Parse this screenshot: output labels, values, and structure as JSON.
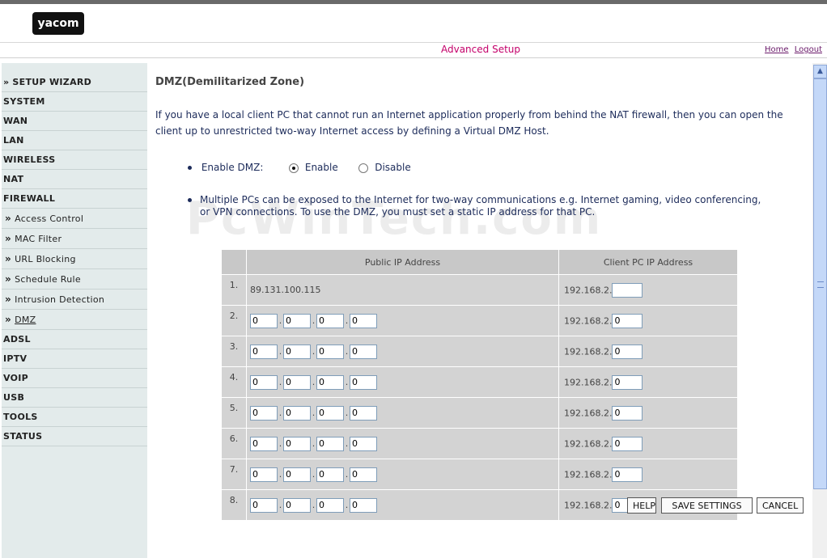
{
  "header": {
    "logo_text": "yacom",
    "page_heading": "Advanced Setup",
    "home_link": "Home",
    "logout_link": "Logout"
  },
  "sidebar": {
    "items": [
      {
        "label": "SETUP WIZARD",
        "prefix": "»"
      },
      {
        "label": "SYSTEM"
      },
      {
        "label": "WAN"
      },
      {
        "label": "LAN"
      },
      {
        "label": "WIRELESS"
      },
      {
        "label": "NAT"
      },
      {
        "label": "FIREWALL"
      }
    ],
    "firewall_sub": [
      {
        "label": "Access Control"
      },
      {
        "label": "MAC Filter"
      },
      {
        "label": "URL Blocking"
      },
      {
        "label": "Schedule Rule"
      },
      {
        "label": "Intrusion Detection"
      },
      {
        "label": "DMZ"
      }
    ],
    "lower_items": [
      {
        "label": "ADSL"
      },
      {
        "label": "IPTV"
      },
      {
        "label": "VOIP"
      },
      {
        "label": "USB"
      },
      {
        "label": "TOOLS"
      },
      {
        "label": "STATUS"
      }
    ]
  },
  "main": {
    "title": "DMZ(Demilitarized Zone)",
    "intro": "If you have a local client PC that cannot run an Internet application properly from behind the NAT firewall, then you can open the client up to unrestricted two-way Internet access by defining a Virtual DMZ Host.",
    "enable_label": "Enable DMZ:",
    "enable_option": "Enable",
    "disable_option": "Disable",
    "enabled": true,
    "note": "Multiple PCs can be exposed to the Internet for two-way communications e.g. Internet gaming, video conferencing, or VPN connections.  To use the DMZ, you must set a static IP address for that PC.",
    "watermark": "PcWinTech.com",
    "table": {
      "headers": [
        "",
        "Public IP Address",
        "Client PC IP Address"
      ],
      "client_prefix": "192.168.2.",
      "rows": [
        {
          "num": "1.",
          "public_text": "89.131.100.115",
          "client": ""
        },
        {
          "num": "2.",
          "public": [
            "0",
            "0",
            "0",
            "0"
          ],
          "client": "0"
        },
        {
          "num": "3.",
          "public": [
            "0",
            "0",
            "0",
            "0"
          ],
          "client": "0"
        },
        {
          "num": "4.",
          "public": [
            "0",
            "0",
            "0",
            "0"
          ],
          "client": "0"
        },
        {
          "num": "5.",
          "public": [
            "0",
            "0",
            "0",
            "0"
          ],
          "client": "0"
        },
        {
          "num": "6.",
          "public": [
            "0",
            "0",
            "0",
            "0"
          ],
          "client": "0"
        },
        {
          "num": "7.",
          "public": [
            "0",
            "0",
            "0",
            "0"
          ],
          "client": "0"
        },
        {
          "num": "8.",
          "public": [
            "0",
            "0",
            "0",
            "0"
          ],
          "client": "0"
        }
      ]
    },
    "buttons": {
      "help": "HELP",
      "save": "SAVE SETTINGS",
      "cancel": "CANCEL"
    }
  }
}
